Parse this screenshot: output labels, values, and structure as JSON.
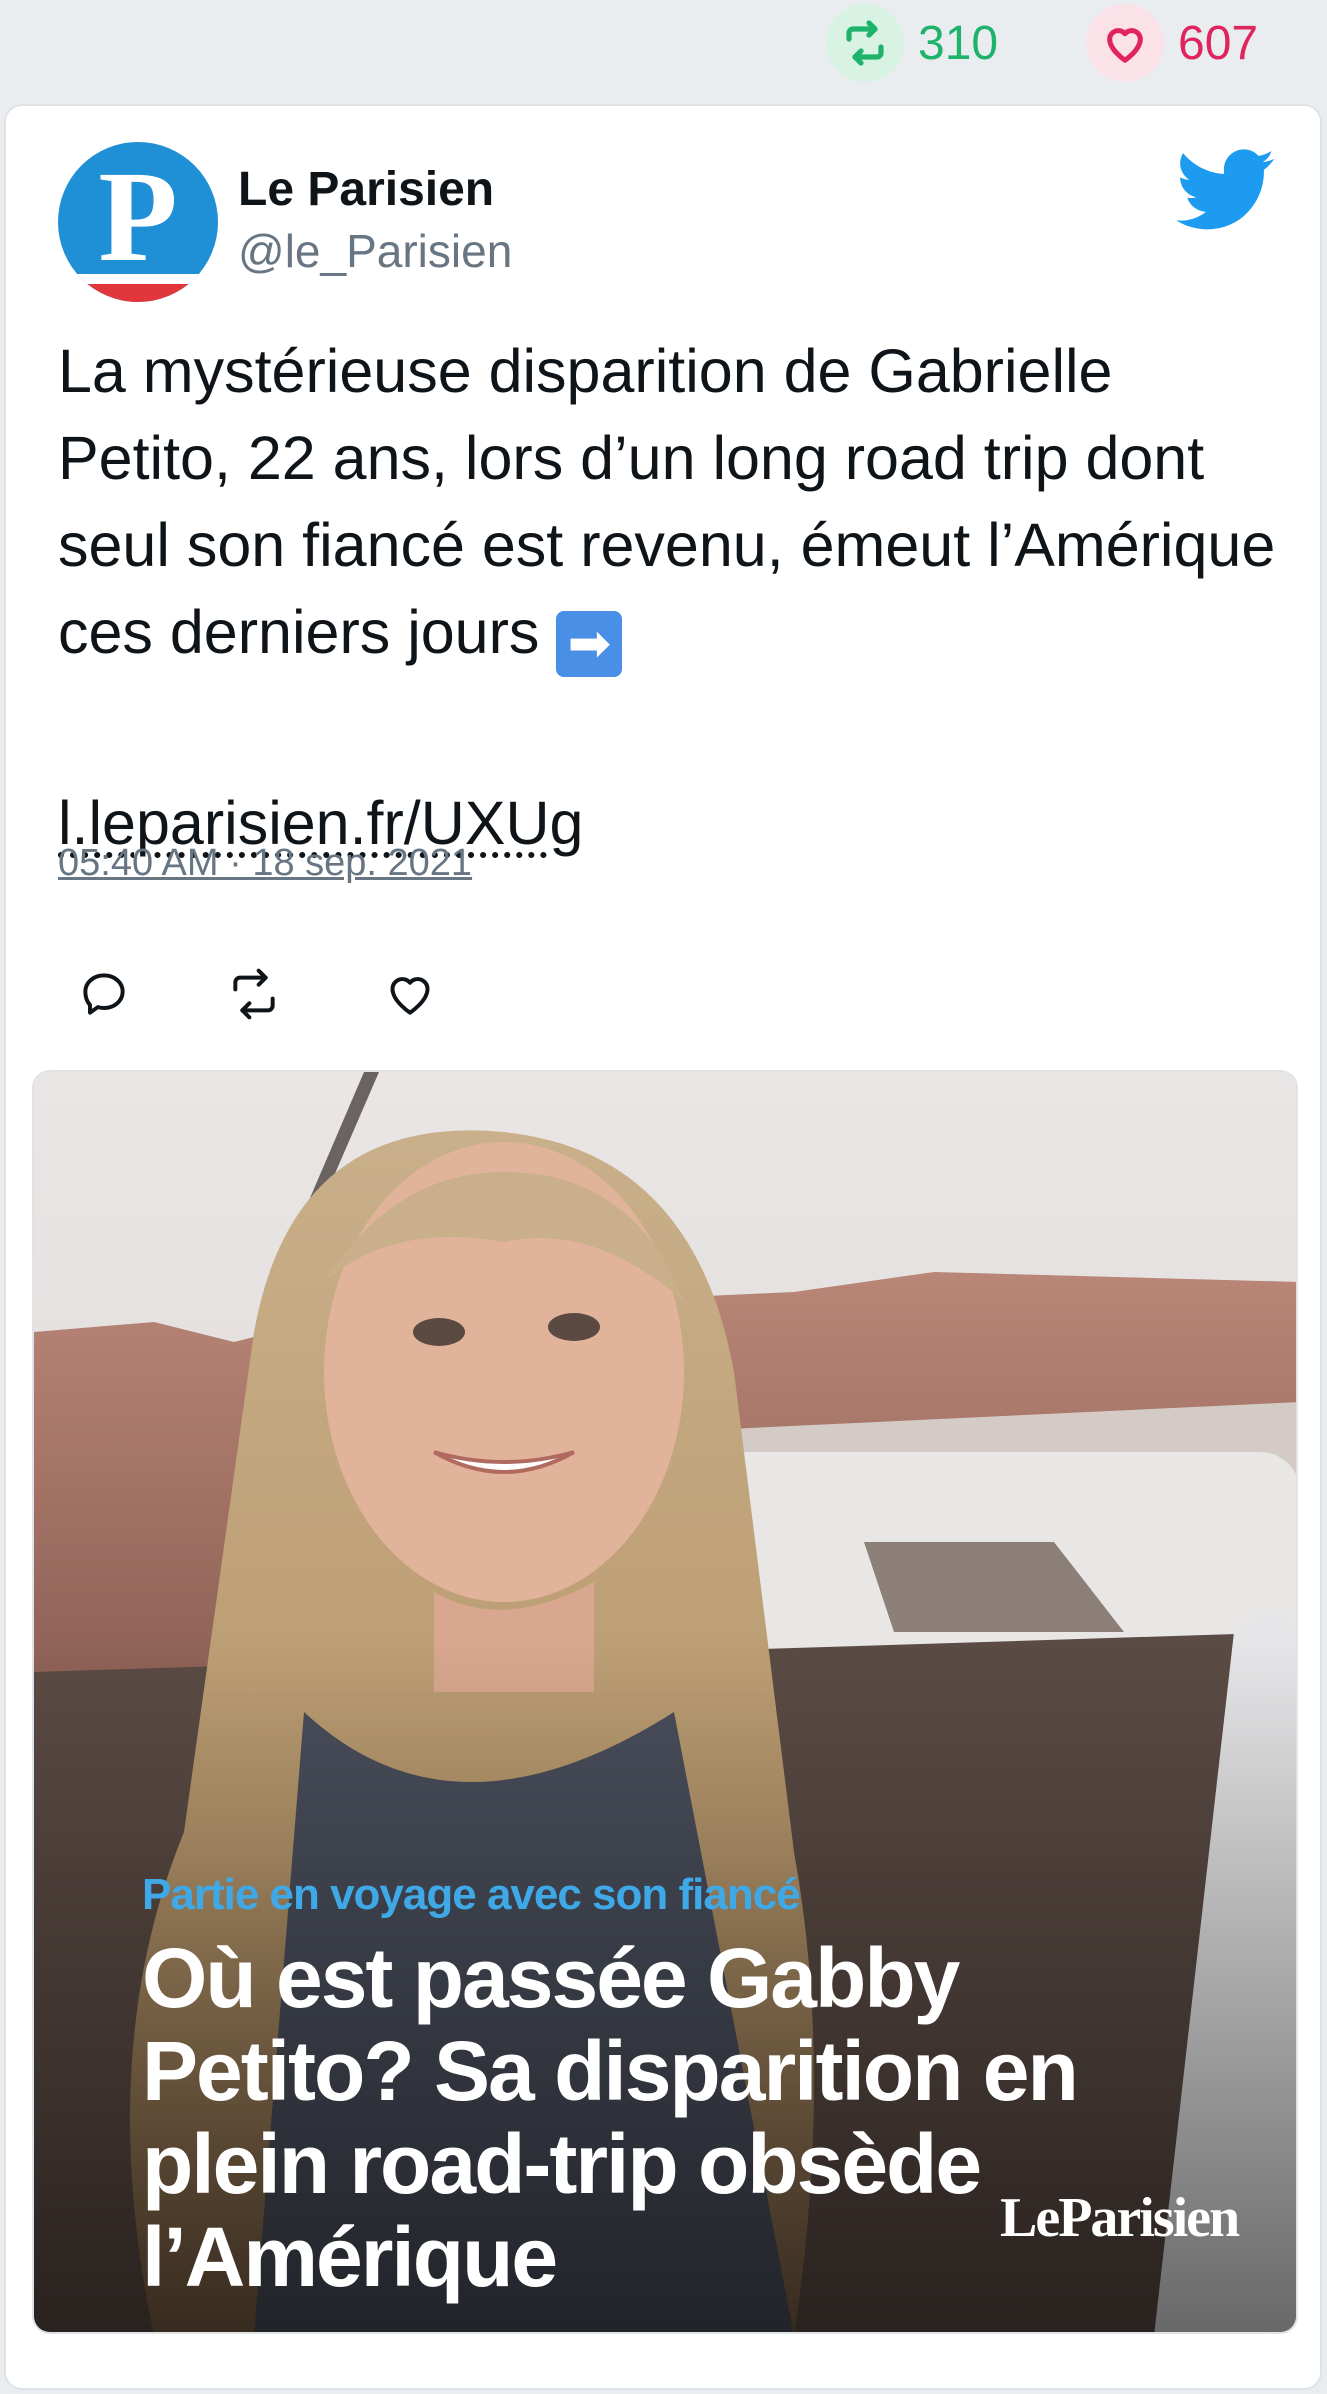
{
  "stats": {
    "retweets": "310",
    "likes": "607",
    "retweet_color": "#1db36b",
    "like_color": "#e0245e"
  },
  "tweet": {
    "author_name": "Le Parisien",
    "author_handle": "@le_Parisien",
    "avatar_letter": "P",
    "text": "La mystérieuse disparition de Gabrielle Petito, 22 ans, lors d’un long road trip dont seul son fiancé est revenu, émeut l’Amérique ces derniers jours",
    "arrow_emoji": "➡",
    "link": "l.leparisien.fr/UXUg",
    "timestamp": "05:40 AM · 18 sep. 2021"
  },
  "icons": {
    "platform": "twitter-bird-icon",
    "actions": [
      "reply-icon",
      "retweet-icon",
      "like-icon"
    ]
  },
  "media": {
    "kicker": "Partie en voyage avec son fiancé",
    "headline": "Où est passée Gabby Petito? Sa disparition en plein road-trip obsède l’Amérique",
    "logo": "LeParisien"
  }
}
